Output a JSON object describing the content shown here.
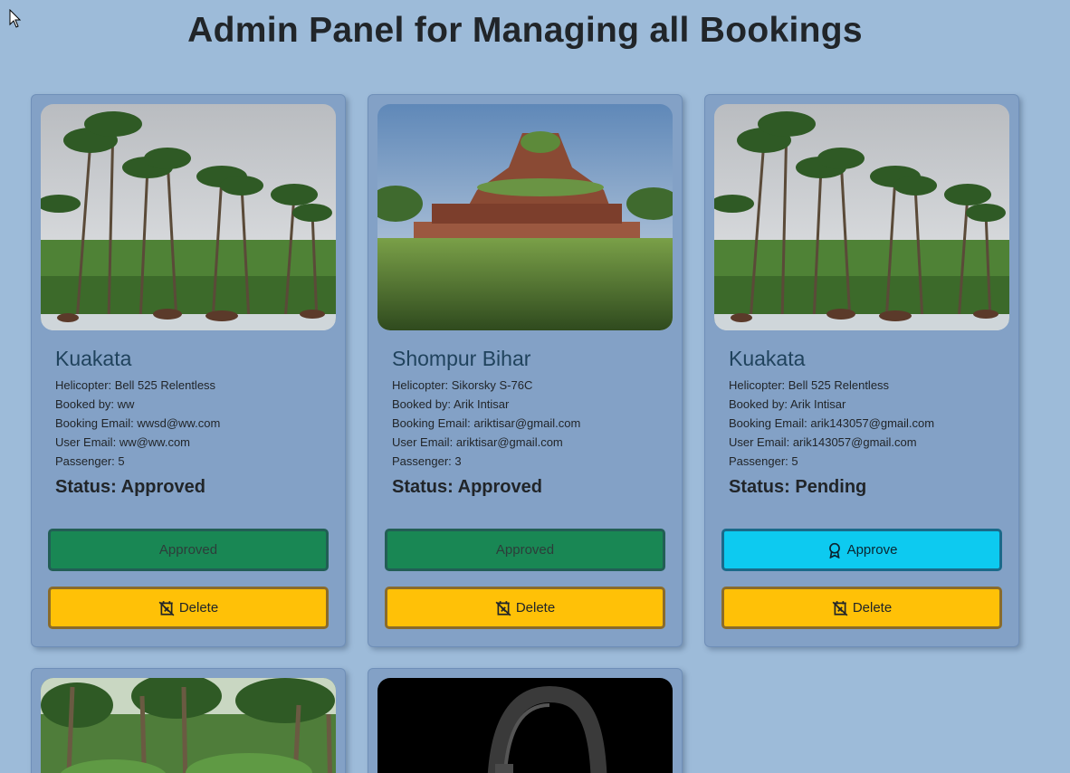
{
  "page": {
    "title": "Admin Panel for Managing all Bookings"
  },
  "labels": {
    "helicopter": "Helicopter:",
    "booked_by": "Booked by:",
    "booking_email": "Booking Email:",
    "user_email": "User Email:",
    "passenger": "Passenger:",
    "status": "Status:"
  },
  "bookings": [
    {
      "place": "Kuakata",
      "helicopter": "Bell 525 Relentless",
      "booked_by": "ww",
      "booking_email": "wwsd@ww.com",
      "user_email": "ww@ww.com",
      "passenger": "5",
      "status": "Approved",
      "action_label": "Approved",
      "delete_label": "Delete"
    },
    {
      "place": "Shompur Bihar",
      "helicopter": "Sikorsky S-76C",
      "booked_by": "Arik Intisar",
      "booking_email": "ariktisar@gmail.com",
      "user_email": "ariktisar@gmail.com",
      "passenger": "3",
      "status": "Approved",
      "action_label": "Approved",
      "delete_label": "Delete"
    },
    {
      "place": "Kuakata",
      "helicopter": "Bell 525 Relentless",
      "booked_by": "Arik Intisar",
      "booking_email": "arik143057@gmail.com",
      "user_email": "arik143057@gmail.com",
      "passenger": "5",
      "status": "Pending",
      "action_label": "Approve",
      "delete_label": "Delete"
    }
  ],
  "colors": {
    "background": "#9dbbd9",
    "card": "#83a1c6",
    "approved_button": "#198754",
    "approve_button": "#0dcaf0",
    "delete_button": "#ffc107"
  },
  "icons": {
    "approve": "award-icon",
    "delete": "calendar-x-icon",
    "cursor": "mouse-pointer-icon"
  }
}
